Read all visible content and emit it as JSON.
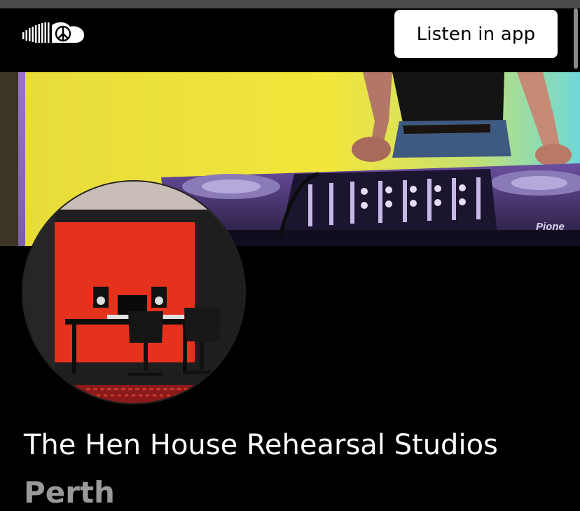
{
  "header": {
    "logo_icon": "soundcloud-logo-icon",
    "listen_button_label": "Listen in app"
  },
  "banner": {
    "image": "dj-mixer-banner",
    "mixer_brand": "Pione"
  },
  "profile": {
    "avatar_image": "studio-room-photo",
    "name": "The Hen House Rehearsal Studios",
    "city": "Perth"
  },
  "colors": {
    "background": "#000000",
    "button_bg": "#ffffff",
    "city_text": "#9a9a9a",
    "banner_yellow": "#f2e23a",
    "wall_red": "#e4321c"
  }
}
